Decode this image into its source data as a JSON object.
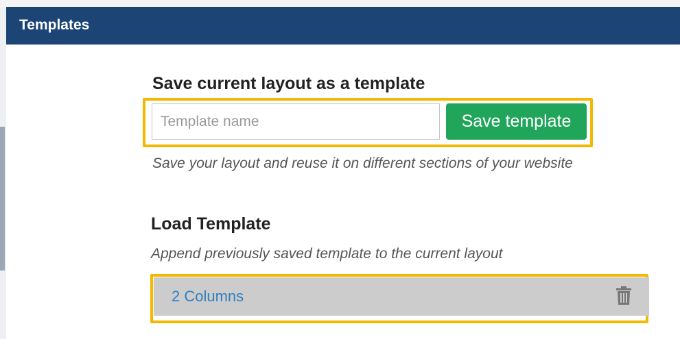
{
  "header": {
    "title": "Templates"
  },
  "save_section": {
    "title": "Save current layout as a template",
    "input_placeholder": "Template name",
    "input_value": "",
    "save_button_label": "Save template",
    "hint": "Save your layout and reuse it on different sections of your website"
  },
  "load_section": {
    "title": "Load Template",
    "hint": "Append previously saved template to the current layout",
    "templates": [
      {
        "name": "2 Columns",
        "action_icon": "trash-icon"
      }
    ]
  },
  "colors": {
    "header_bg": "#1c4576",
    "save_button": "#21a55a",
    "link": "#2f7fc1",
    "highlight": "#f5b800",
    "row_bg": "#cccccc"
  }
}
